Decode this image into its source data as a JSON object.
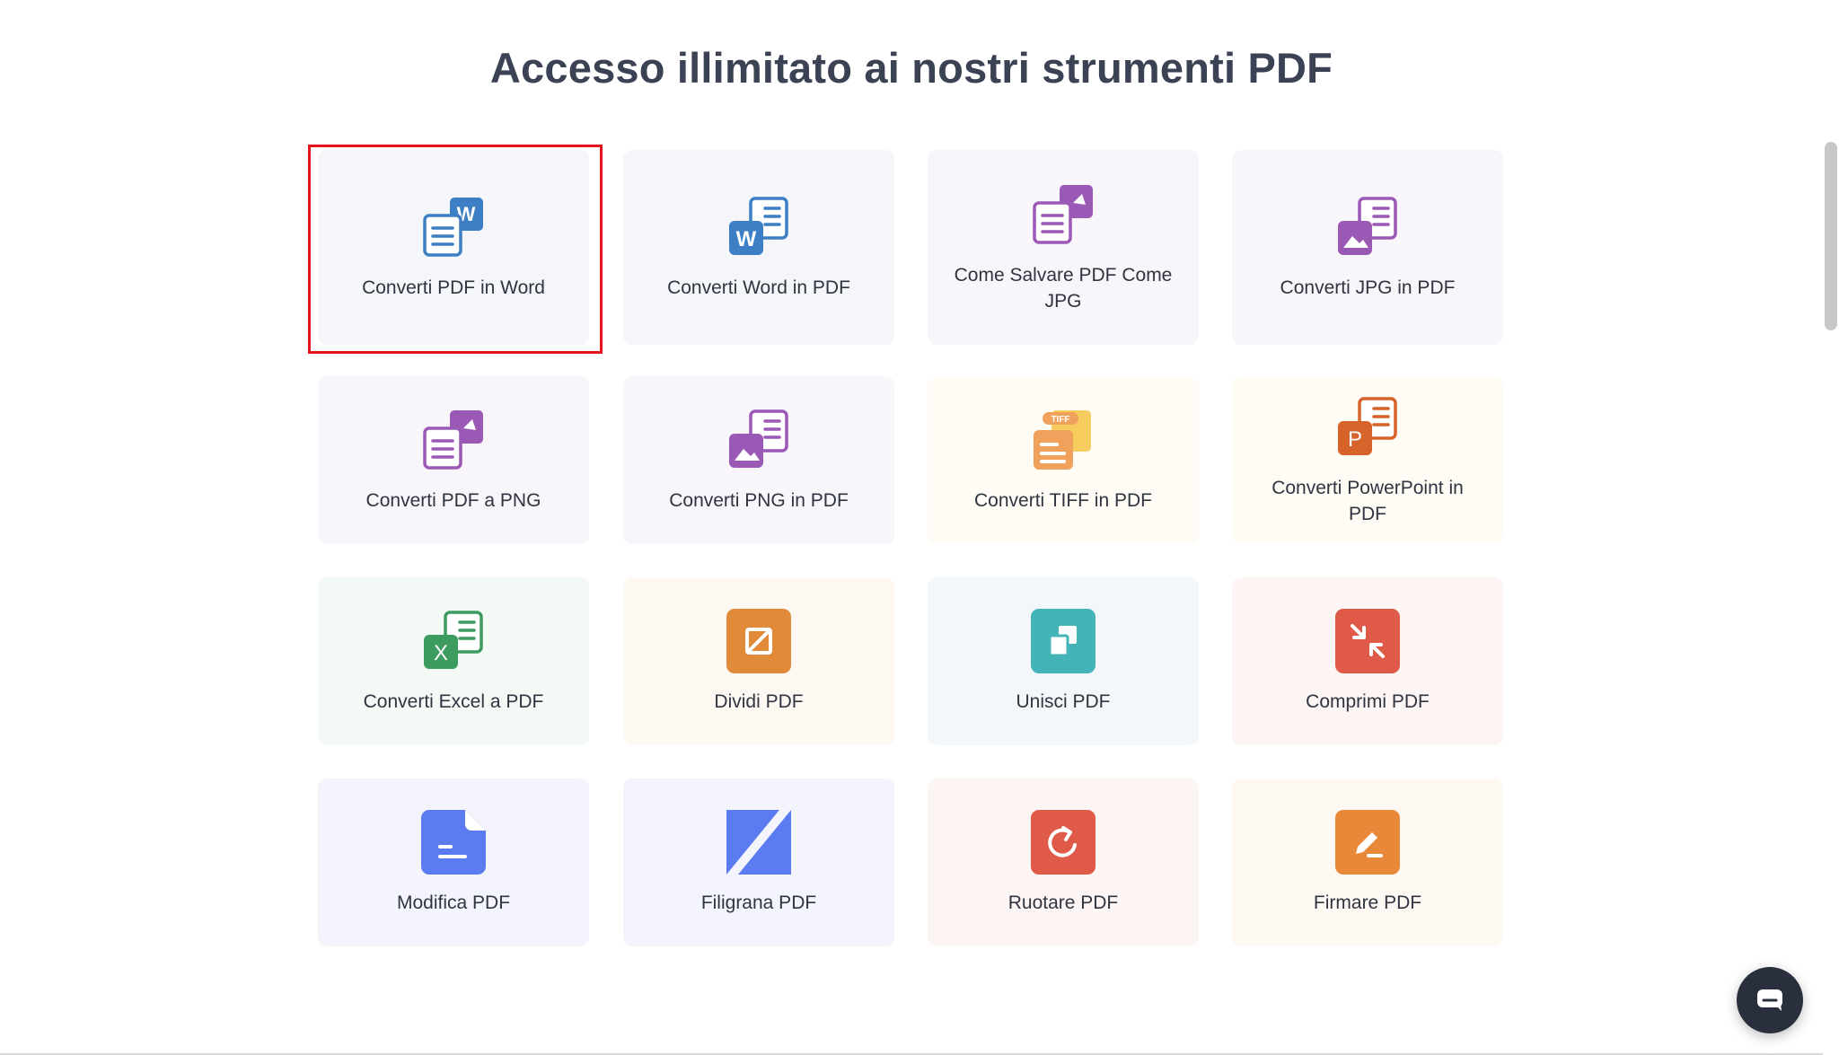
{
  "page": {
    "title": "Accesso illimitato ai nostri strumenti PDF"
  },
  "tools": [
    {
      "label": "Converti PDF in Word",
      "icon": "pdf-to-word-icon",
      "color": "#3d7fc4"
    },
    {
      "label": "Converti Word in PDF",
      "icon": "word-to-pdf-icon",
      "color": "#3d7fc4"
    },
    {
      "label": "Come Salvare PDF Come JPG",
      "icon": "pdf-to-jpg-icon",
      "color": "#9b59b6"
    },
    {
      "label": "Converti JPG in PDF",
      "icon": "jpg-to-pdf-icon",
      "color": "#9b59b6"
    },
    {
      "label": "Converti PDF a PNG",
      "icon": "pdf-to-png-icon",
      "color": "#9b59b6"
    },
    {
      "label": "Converti PNG in PDF",
      "icon": "png-to-pdf-icon",
      "color": "#9b59b6"
    },
    {
      "label": "Converti TIFF in PDF",
      "icon": "tiff-to-pdf-icon",
      "color": "#f0a25c",
      "badge": "TIFF"
    },
    {
      "label": "Converti PowerPoint in PDF",
      "icon": "powerpoint-to-pdf-icon",
      "color": "#d5632a",
      "letter": "P"
    },
    {
      "label": "Converti Excel a PDF",
      "icon": "excel-to-pdf-icon",
      "color": "#3e9b5f",
      "letter": "X"
    },
    {
      "label": "Dividi PDF",
      "icon": "split-pdf-icon",
      "color": "#e08a3a"
    },
    {
      "label": "Unisci PDF",
      "icon": "merge-pdf-icon",
      "color": "#45b4b8"
    },
    {
      "label": "Comprimi PDF",
      "icon": "compress-pdf-icon",
      "color": "#e05a4a"
    },
    {
      "label": "Modifica PDF",
      "icon": "edit-pdf-icon",
      "color": "#5b7cf0"
    },
    {
      "label": "Filigrana PDF",
      "icon": "watermark-pdf-icon",
      "color": "#5b7cf0"
    },
    {
      "label": "Ruotare PDF",
      "icon": "rotate-pdf-icon",
      "color": "#e05a4a"
    },
    {
      "label": "Firmare PDF",
      "icon": "sign-pdf-icon",
      "color": "#e8893a"
    }
  ],
  "chat": {
    "icon": "chat-icon"
  },
  "highlight_color": "#e3141b"
}
